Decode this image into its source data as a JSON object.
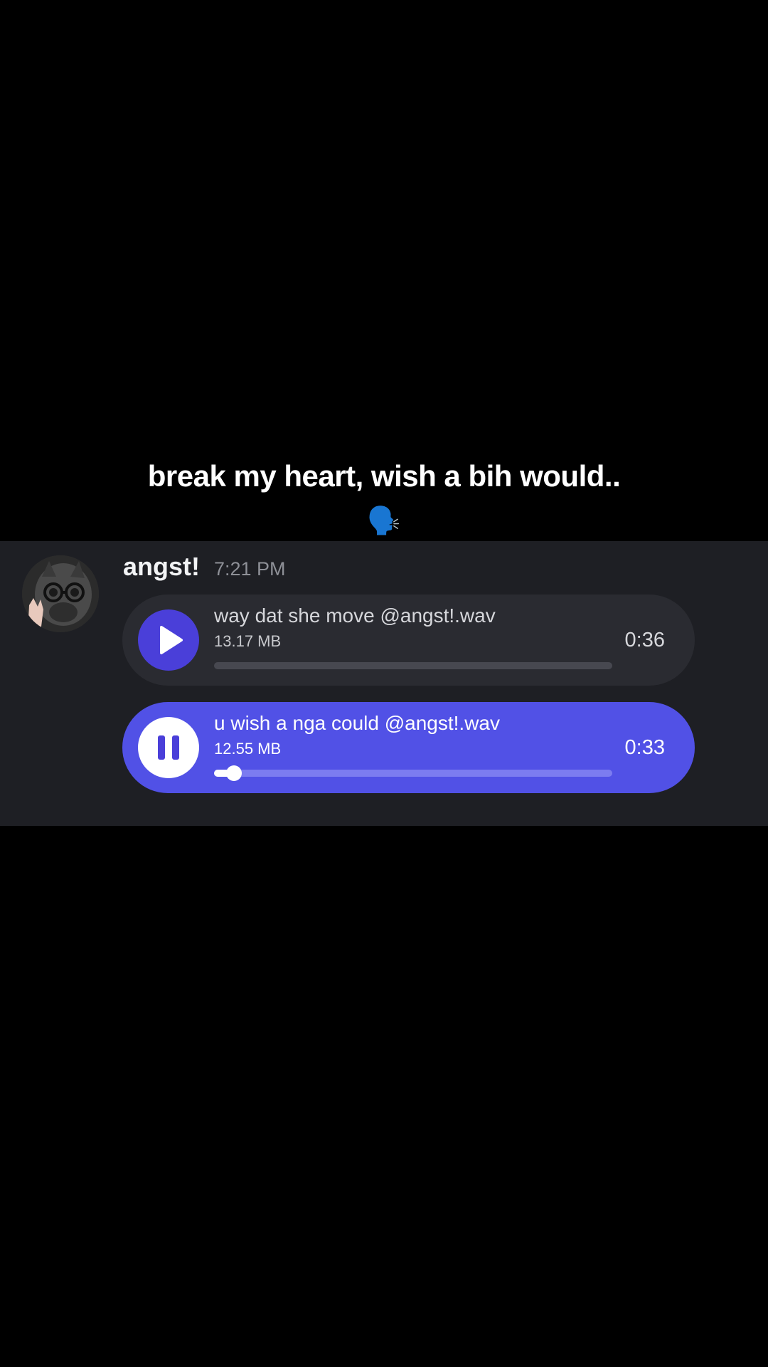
{
  "caption": {
    "text": "break my heart, wish a bih would..",
    "emoji": "🗣️"
  },
  "message": {
    "username": "angst!",
    "timestamp": "7:21 PM",
    "attachments": [
      {
        "file_name": "way dat she move @angst!.wav",
        "file_size": "13.17 MB",
        "duration": "0:36",
        "state": "paused",
        "progress": 0
      },
      {
        "file_name": "u wish a nga could @angst!.wav",
        "file_size": "12.55 MB",
        "duration": "0:33",
        "state": "playing",
        "progress": 0.05
      }
    ]
  },
  "colors": {
    "accent": "#5151e6",
    "play_button": "#4a3fd9",
    "panel": "#1e1f24",
    "card": "#2a2b31"
  },
  "icons": {
    "play": "play-icon",
    "pause": "pause-icon",
    "avatar": "avatar-image"
  }
}
